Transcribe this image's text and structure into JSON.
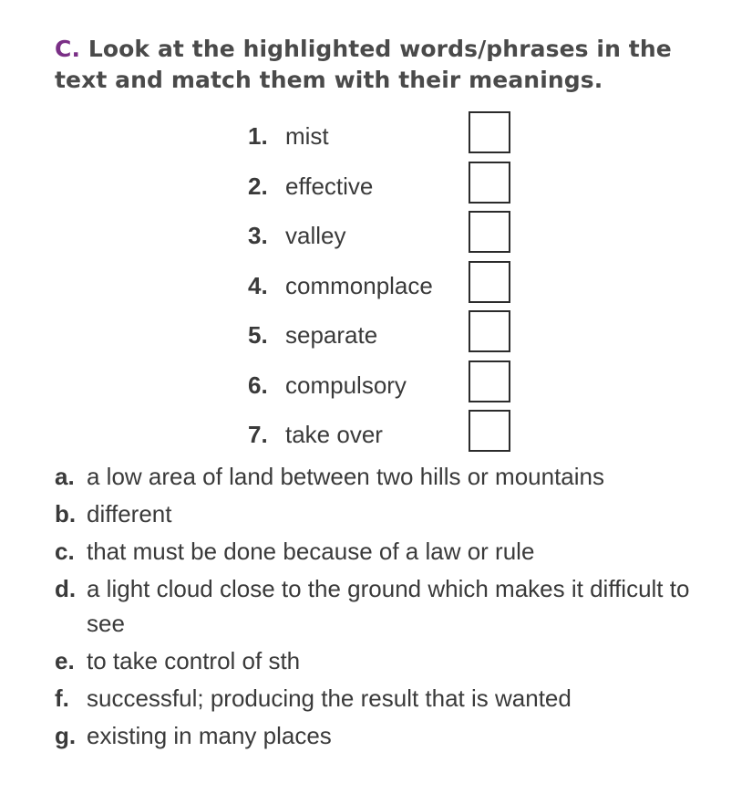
{
  "exercise": {
    "letter": "C.",
    "instruction": " Look at the highlighted words/phrases in the text and match them with their meanings."
  },
  "words": [
    {
      "num": "1.",
      "term": "mist"
    },
    {
      "num": "2.",
      "term": "effective"
    },
    {
      "num": "3.",
      "term": "valley"
    },
    {
      "num": "4.",
      "term": "commonplace"
    },
    {
      "num": "5.",
      "term": "separate"
    },
    {
      "num": "6.",
      "term": "compulsory"
    },
    {
      "num": "7.",
      "term": "take over"
    }
  ],
  "definitions": [
    {
      "letter": "a.",
      "text": "a low area of land between two hills or mountains"
    },
    {
      "letter": "b.",
      "text": "different"
    },
    {
      "letter": "c.",
      "text": "that must be done because of a law or rule"
    },
    {
      "letter": "d.",
      "text": "a light cloud close to the ground which makes it difficult to see"
    },
    {
      "letter": "e.",
      "text": "to take control of sth"
    },
    {
      "letter": "f.",
      "text": "successful; producing the result that is wanted"
    },
    {
      "letter": "g.",
      "text": "existing in many places"
    }
  ]
}
